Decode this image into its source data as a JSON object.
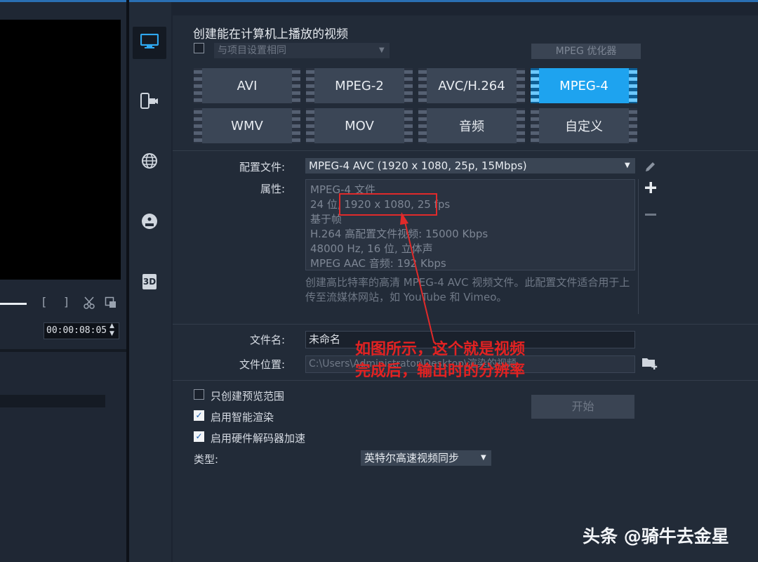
{
  "preview": {
    "timecode": "00:00:08:05",
    "controls": {
      "mark_in": "[",
      "mark_out": "]"
    }
  },
  "nav": {
    "items": [
      {
        "icon": "computer-icon"
      },
      {
        "icon": "mobile-device-icon"
      },
      {
        "icon": "globe-icon"
      },
      {
        "icon": "dvd-icon"
      },
      {
        "icon": "3d-icon",
        "label": "3D"
      }
    ]
  },
  "main": {
    "title": "创建能在计算机上播放的视频",
    "same_as_project": {
      "label": "与项目设置相同",
      "checked": false
    },
    "mpeg_optimizer": "MPEG 优化器",
    "formats": [
      {
        "label": "AVI",
        "active": false
      },
      {
        "label": "MPEG-2",
        "active": false
      },
      {
        "label": "AVC/H.264",
        "active": false
      },
      {
        "label": "MPEG-4",
        "active": true
      },
      {
        "label": "WMV",
        "active": false
      },
      {
        "label": "MOV",
        "active": false
      },
      {
        "label": "音频",
        "active": false
      },
      {
        "label": "自定义",
        "active": false
      }
    ],
    "profile": {
      "label": "配置文件:",
      "value": "MPEG-4 AVC (1920 x 1080, 25p, 15Mbps)"
    },
    "properties": {
      "label": "属性:",
      "lines": [
        "MPEG-4 文件",
        "24 位, 1920 x 1080, 25 fps",
        "基于帧",
        "H.264 高配置文件视频: 15000 Kbps",
        "48000 Hz, 16 位, 立体声",
        "MPEG AAC 音频: 192 Kbps"
      ]
    },
    "description": "创建高比特率的高清 MPEG-4 AVC 视频文件。此配置文件适合用于上传至流媒体网站，如 YouTube 和 Vimeo。",
    "filename": {
      "label": "文件名:",
      "value": "未命名"
    },
    "location": {
      "label": "文件位置:",
      "value": "C:\\Users\\Administrator\\Desktop\\渲染的视频"
    },
    "options": [
      {
        "label": "只创建预览范围",
        "checked": false
      },
      {
        "label": "启用智能渲染",
        "checked": true
      },
      {
        "label": "启用硬件解码器加速",
        "checked": true
      }
    ],
    "start_button": "开始",
    "type": {
      "label": "类型:",
      "value": "英特尔高速视频同步"
    }
  },
  "annotation": {
    "text_line1": "如图所示，这个就是视频",
    "text_line2": "完成后，输出时的分辨率"
  },
  "watermark": "头条 @骑牛去金星",
  "colors": {
    "accent": "#1ea3ef",
    "annotation": "#e02a2a"
  }
}
